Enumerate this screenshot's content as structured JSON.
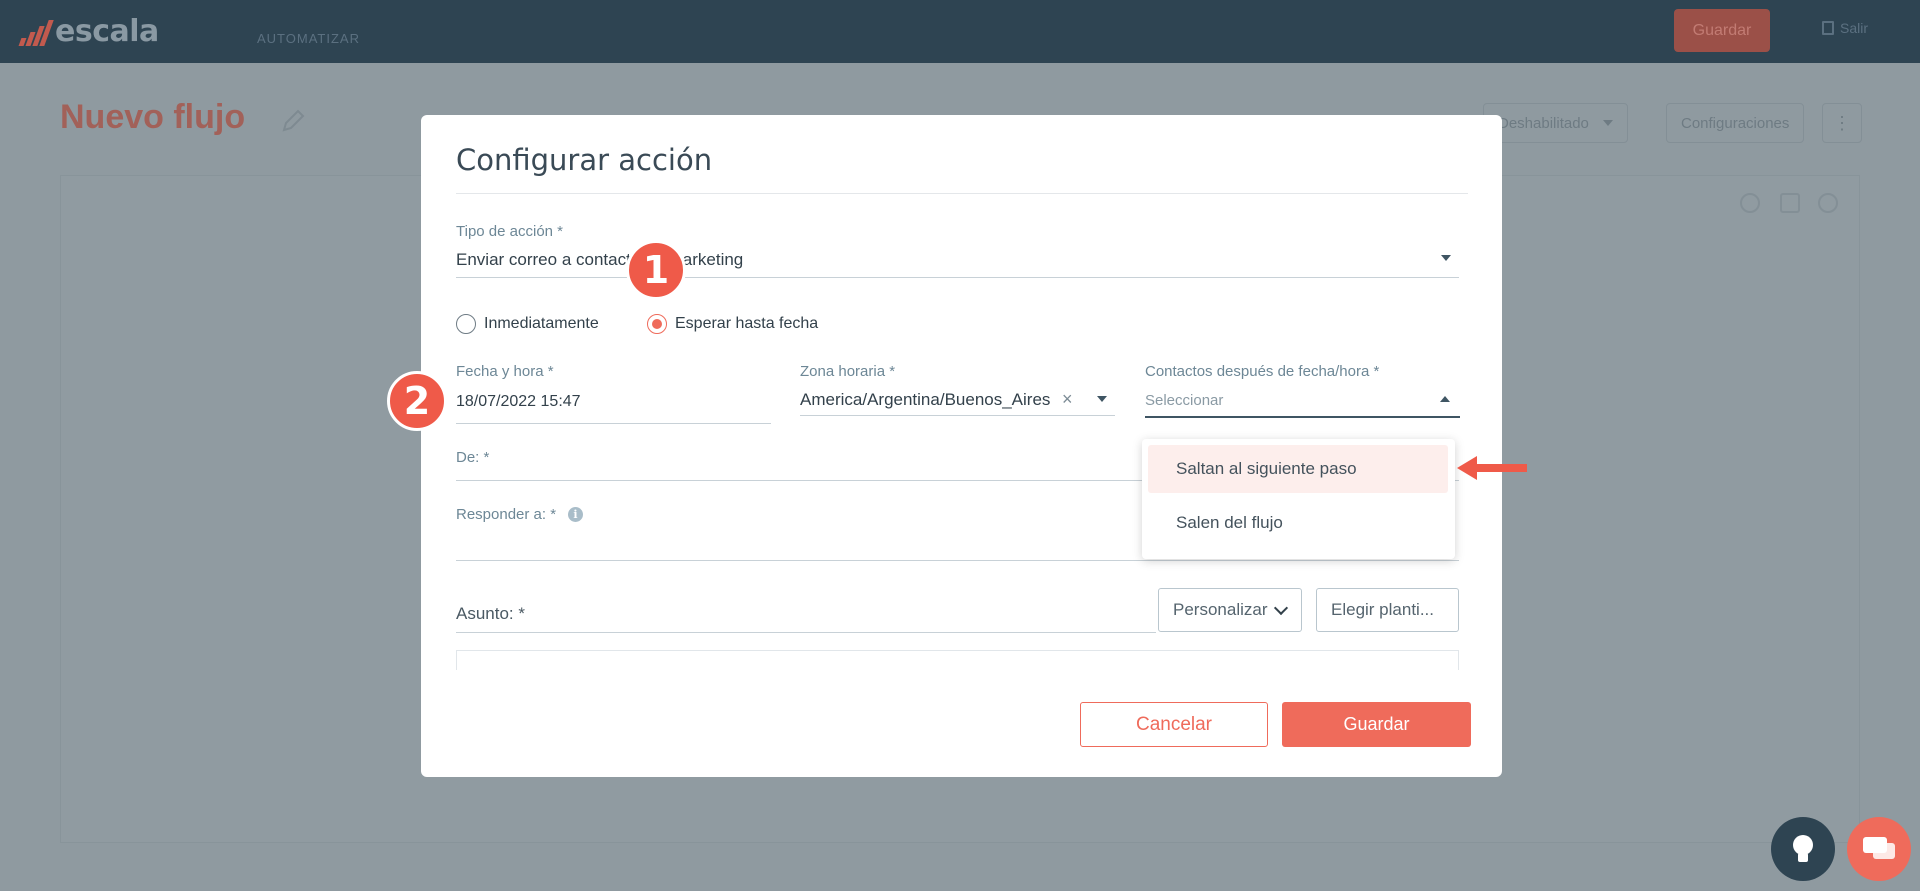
{
  "topbar": {
    "brand": "escala",
    "nav_label": "AUTOMATIZAR",
    "save_label": "Guardar",
    "exit_label": "Salir"
  },
  "background": {
    "page_title": "Nuevo flujo",
    "status_select": "Deshabilitado",
    "settings_label": "Configuraciones"
  },
  "modal": {
    "title": "Configurar acción",
    "action_type": {
      "label": "Tipo de acción *",
      "value": "Enviar correo a contacto de marketing"
    },
    "timing": {
      "immediately_label": "Inmediatamente",
      "wait_label": "Esperar hasta fecha",
      "selected": "wait"
    },
    "datetime": {
      "label": "Fecha y hora *",
      "value": "18/07/2022 15:47"
    },
    "timezone": {
      "label": "Zona horaria *",
      "value": "America/Argentina/Buenos_Aires"
    },
    "after_contacts": {
      "label": "Contactos después de fecha/hora *",
      "placeholder": "Seleccionar",
      "options": [
        "Saltan al siguiente paso",
        "Salen del flujo"
      ],
      "highlighted_index": 0
    },
    "from": {
      "label": "De:  *"
    },
    "reply_to": {
      "label": "Responder a: *"
    },
    "subject": {
      "label": "Asunto: *",
      "personalize_label": "Personalizar",
      "template_label": "Elegir planti..."
    },
    "cancel_label": "Cancelar",
    "save_label": "Guardar"
  },
  "annotations": {
    "step_1": "1",
    "step_2": "2"
  },
  "colors": {
    "accent": "#ef6b5b",
    "topbar": "#2e4452",
    "overlay": "#8f9aa0"
  }
}
